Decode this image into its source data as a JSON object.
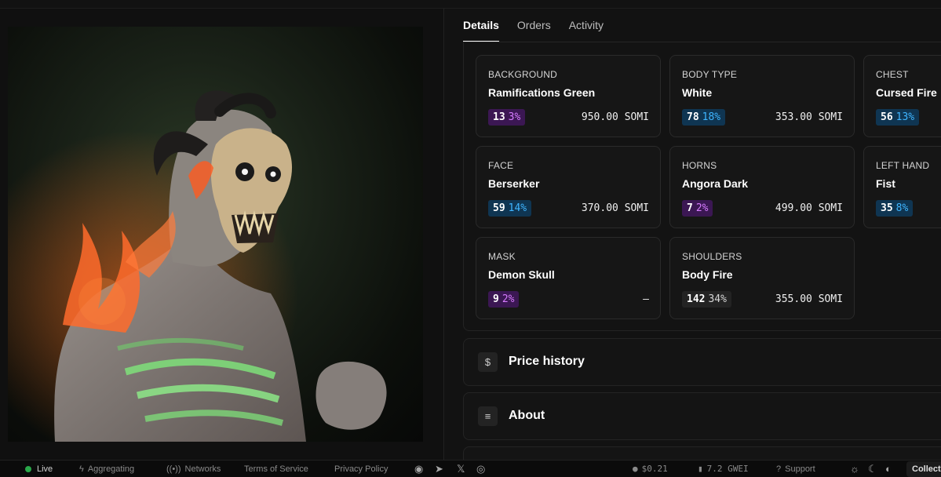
{
  "tabs": [
    {
      "label": "Details",
      "active": true
    },
    {
      "label": "Orders",
      "active": false
    },
    {
      "label": "Activity",
      "active": false
    }
  ],
  "traits": [
    {
      "type": "BACKGROUND",
      "value": "Ramifications Green",
      "count": "13",
      "percent": "3%",
      "rarity_color": "purple",
      "price": "950.00 SOMI"
    },
    {
      "type": "BODY TYPE",
      "value": "White",
      "count": "78",
      "percent": "18%",
      "rarity_color": "blue",
      "price": "353.00 SOMI"
    },
    {
      "type": "CHEST",
      "value": "Cursed Fire",
      "count": "56",
      "percent": "13%",
      "rarity_color": "blue",
      "price": ""
    },
    {
      "type": "FACE",
      "value": "Berserker",
      "count": "59",
      "percent": "14%",
      "rarity_color": "blue",
      "price": "370.00 SOMI"
    },
    {
      "type": "HORNS",
      "value": "Angora Dark",
      "count": "7",
      "percent": "2%",
      "rarity_color": "purple",
      "price": "499.00 SOMI"
    },
    {
      "type": "LEFT HAND",
      "value": "Fist",
      "count": "35",
      "percent": "8%",
      "rarity_color": "blue",
      "price": ""
    },
    {
      "type": "MASK",
      "value": "Demon Skull",
      "count": "9",
      "percent": "2%",
      "rarity_color": "purple",
      "price": "–"
    },
    {
      "type": "SHOULDERS",
      "value": "Body Fire",
      "count": "142",
      "percent": "34%",
      "rarity_color": "gray",
      "price": "355.00 SOMI"
    }
  ],
  "sections": {
    "price_history": {
      "icon": "dollar-icon",
      "glyph": "$",
      "title": "Price history"
    },
    "about": {
      "icon": "notes-icon",
      "glyph": "≡",
      "title": "About"
    }
  },
  "footer": {
    "live": "Live",
    "aggregating": "Aggregating",
    "networks": "Networks",
    "terms": "Terms of Service",
    "privacy": "Privacy Policy",
    "token_price": "$0.21",
    "gas": "7.2 GWEI",
    "support": "Support",
    "collect": "Collect"
  },
  "colors": {
    "background": "#111111",
    "purple_badge": "#3b1753",
    "blue_badge": "#0f3552",
    "live_dot": "#2aa84a"
  }
}
